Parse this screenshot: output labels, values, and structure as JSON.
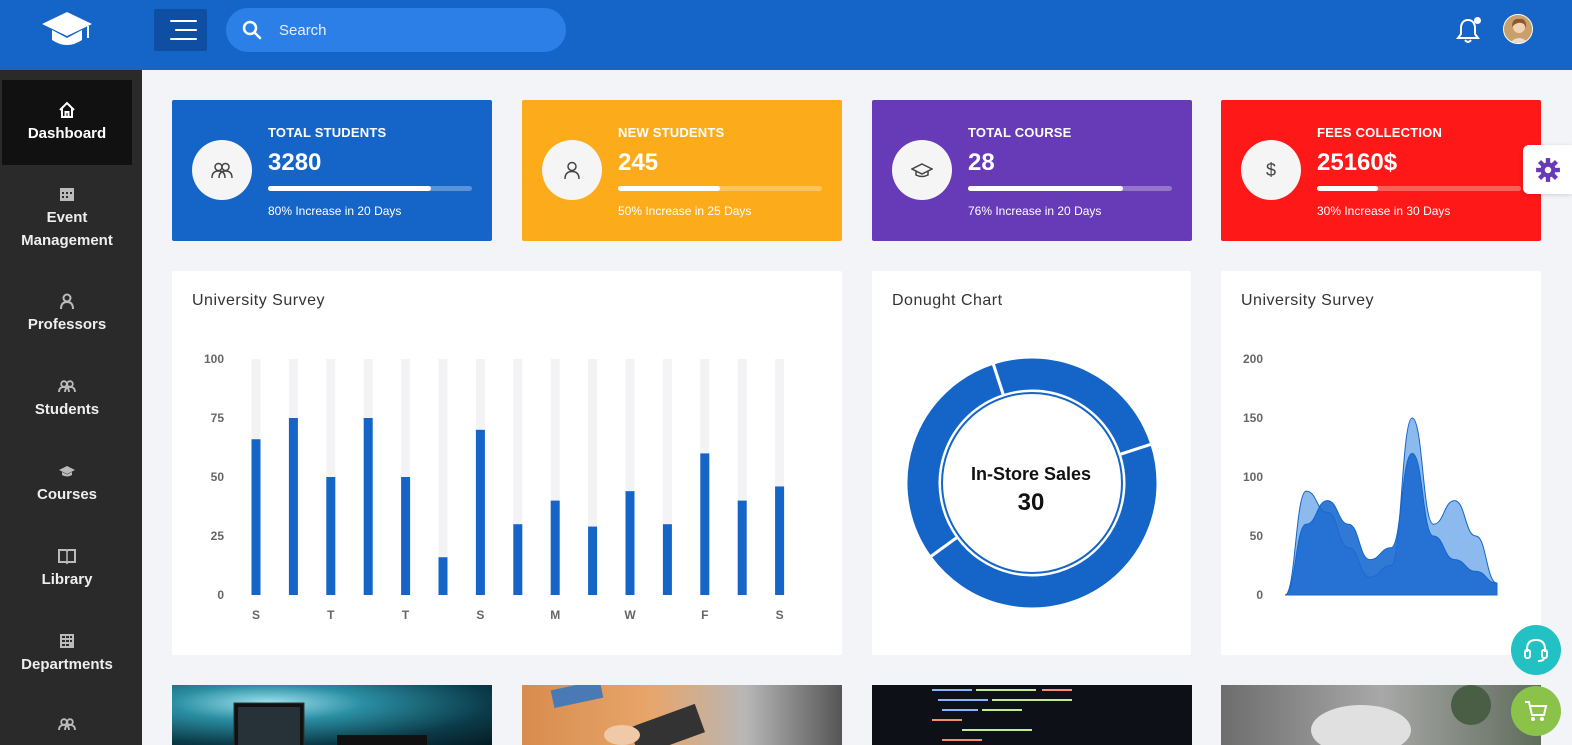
{
  "header": {
    "search_placeholder": "Search"
  },
  "sidebar": {
    "items": [
      {
        "label": "Dashboard",
        "icon": "home-icon"
      },
      {
        "label": "Event\nManagement",
        "icon": "calendar-icon"
      },
      {
        "label": "Professors",
        "icon": "user-icon"
      },
      {
        "label": "Students",
        "icon": "users-icon"
      },
      {
        "label": "Courses",
        "icon": "graduation-cap-icon"
      },
      {
        "label": "Library",
        "icon": "book-icon"
      },
      {
        "label": "Departments",
        "icon": "building-icon"
      }
    ]
  },
  "stats": [
    {
      "label": "TOTAL STUDENTS",
      "value": "3280",
      "progress": 0.8,
      "note": "80% Increase in 20 Days",
      "color": "#1565c8",
      "icon": "users-icon"
    },
    {
      "label": "NEW STUDENTS",
      "value": "245",
      "progress": 0.5,
      "note": "50% Increase in 25 Days",
      "color": "#fcab1b",
      "icon": "user-icon"
    },
    {
      "label": "TOTAL COURSE",
      "value": "28",
      "progress": 0.76,
      "note": "76% Increase in 20 Days",
      "color": "#673ab7",
      "icon": "graduation-cap-icon"
    },
    {
      "label": "FEES COLLECTION",
      "value": "25160$",
      "progress": 0.3,
      "note": "30% Increase in 30 Days",
      "color": "#fe1818",
      "icon": "dollar-icon"
    }
  ],
  "panels": {
    "bar_title": "University Survey",
    "donut_title": "Donught Chart",
    "area_title": "University Survey",
    "donut_center_label": "In-Store Sales",
    "donut_center_value": "30"
  },
  "chart_data": [
    {
      "type": "bar",
      "title": "University Survey",
      "categories": [
        "S",
        "",
        "T",
        "",
        "T",
        "",
        "S",
        "",
        "M",
        "",
        "W",
        "",
        "F",
        "",
        "S"
      ],
      "values": [
        66,
        75,
        50,
        75,
        50,
        16,
        70,
        30,
        40,
        29,
        44,
        30,
        60,
        40,
        46
      ],
      "ylim": [
        0,
        100
      ],
      "yticks": [
        0,
        25,
        50,
        75,
        100
      ],
      "color": "#1565c8",
      "background_color": "#f3f3f6"
    },
    {
      "type": "pie",
      "title": "Donught Chart",
      "values": [
        30,
        25,
        45
      ],
      "color": "#1565c8",
      "center_label": "In-Store Sales",
      "center_value": "30"
    },
    {
      "type": "area",
      "title": "University Survey",
      "ylim": [
        0,
        200
      ],
      "yticks": [
        0,
        50,
        100,
        150,
        200
      ],
      "x": [
        0,
        1,
        2,
        3,
        4,
        5,
        6,
        7,
        8,
        9,
        10
      ],
      "series": [
        {
          "values": [
            0,
            88,
            70,
            40,
            15,
            25,
            150,
            60,
            80,
            50,
            10
          ],
          "color": "#7fb1ec"
        },
        {
          "values": [
            0,
            60,
            80,
            60,
            30,
            40,
            120,
            50,
            30,
            20,
            10
          ],
          "color": "#1a6ad0"
        }
      ]
    }
  ],
  "colors": {
    "header": "#1565c8",
    "sidebar": "#2a2a2a",
    "accent": "#1565c8",
    "gear": "#673ab7",
    "support_fab": "#22c1c3",
    "cart_fab": "#8bc34a"
  }
}
